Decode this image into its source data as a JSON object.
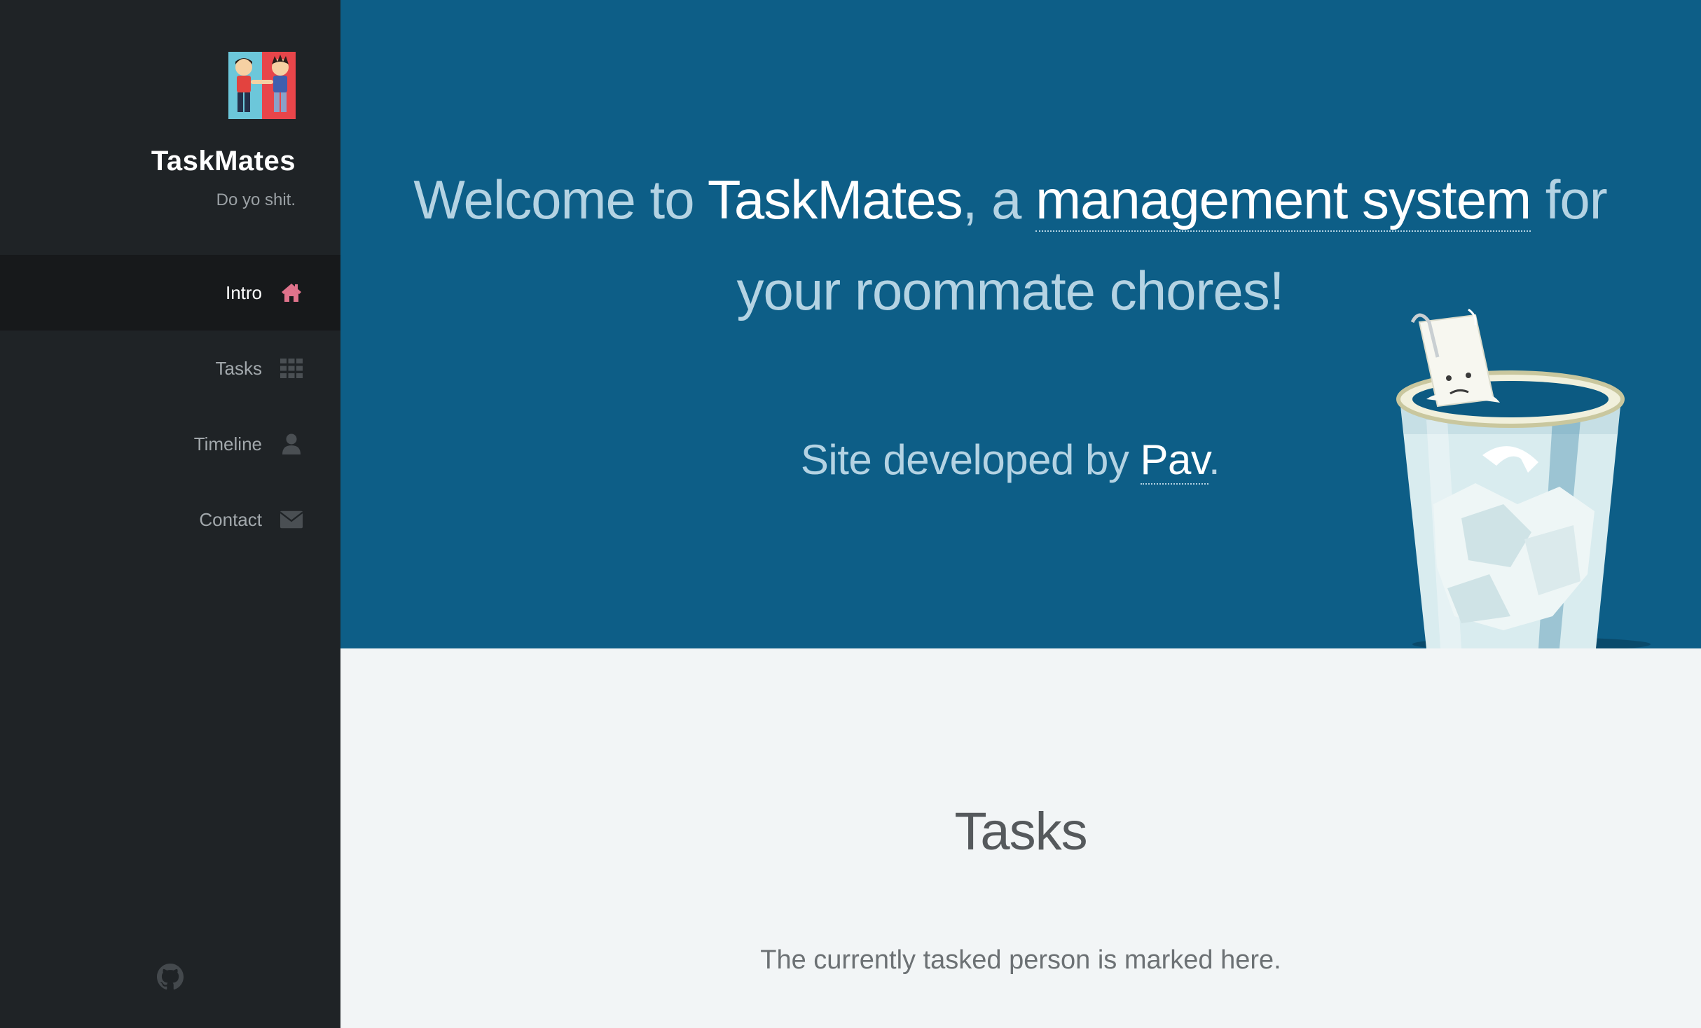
{
  "sidebar": {
    "logo_icon": "roommates-logo-icon",
    "title": "TaskMates",
    "tagline": "Do yo shit.",
    "items": [
      {
        "label": "Intro",
        "icon": "home-icon",
        "active": true
      },
      {
        "label": "Tasks",
        "icon": "grid-icon",
        "active": false
      },
      {
        "label": "Timeline",
        "icon": "user-icon",
        "active": false
      },
      {
        "label": "Contact",
        "icon": "envelope-icon",
        "active": false
      }
    ],
    "footer_icon": "github-icon"
  },
  "hero": {
    "heading_part1": "Welcome to ",
    "heading_brand": "TaskMates",
    "heading_part2": ", a ",
    "heading_link": "management system",
    "heading_part3": " for your roommate chores!",
    "credit_prefix": "Site developed by ",
    "credit_link": "Pav",
    "credit_suffix": ".",
    "illustration": "sad-paper-in-trash-can-illustration"
  },
  "tasks_section": {
    "title": "Tasks",
    "subtitle": "The currently tasked person is marked here."
  },
  "colors": {
    "sidebar_bg": "#1f2326",
    "sidebar_active_bg": "#17191b",
    "hero_bg": "#0d5e87",
    "hero_text": "#b4d3e3",
    "accent_icon": "#e0738c",
    "section_bg": "#f2f5f6"
  }
}
